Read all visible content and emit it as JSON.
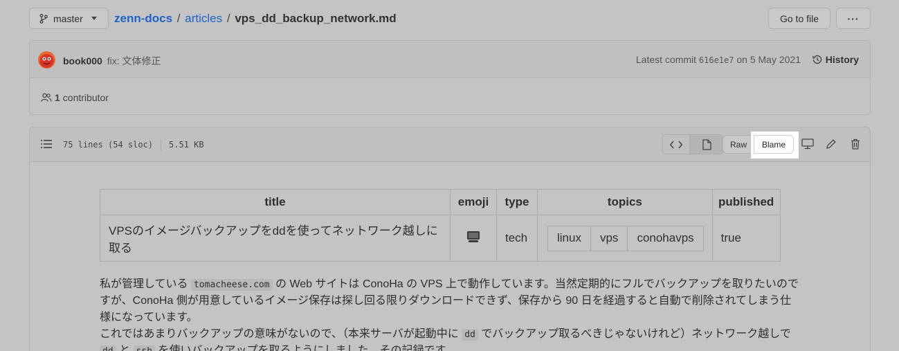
{
  "breadcrumb": {
    "branch": "master",
    "repo": "zenn-docs",
    "sep1": "/",
    "folder": "articles",
    "sep2": "/",
    "file": "vps_dd_backup_network.md"
  },
  "buttons": {
    "go_to_file": "Go to file",
    "more": "···"
  },
  "commit": {
    "author": "book000",
    "message": "fix: 文体修正",
    "latest_label": "Latest commit",
    "sha": "616e1e7",
    "date": "on 5 May 2021",
    "history": "History"
  },
  "contributors": {
    "count": "1",
    "label": "contributor"
  },
  "file_info": {
    "lines": "75 lines (54 sloc)",
    "size": "5.51 KB",
    "raw": "Raw",
    "blame": "Blame"
  },
  "frontmatter": {
    "headers": [
      "title",
      "emoji",
      "type",
      "topics",
      "published"
    ],
    "title": "VPSのイメージバックアップをddを使ってネットワーク越しに取る",
    "emoji": "💻",
    "type": "tech",
    "topics": [
      "linux",
      "vps",
      "conohavps"
    ],
    "published": "true"
  },
  "body": {
    "l1a": "私が管理している",
    "l1code": "tomacheese.com",
    "l1b": "の Web サイトは ConoHa の VPS 上で動作しています。当然定期的にフルでバックアップを取りたいので",
    "l2": "すが、ConoHa 側が用意しているイメージ保存は探し回る限りダウンロードできず、保存から 90 日を経過すると自動で削除されてしまう仕",
    "l3": "様になっています。",
    "l4a": "これではあまりバックアップの意味がないので、（本来サーバが起動中に",
    "l4code": "dd",
    "l4b": "でバックアップ取るべきじゃないけれど）ネットワーク越しで",
    "l5code1": "dd",
    "l5a": "と",
    "l5code2": "ssh",
    "l5b": "を使いバックアップを取るようにしました。その記録です。"
  }
}
